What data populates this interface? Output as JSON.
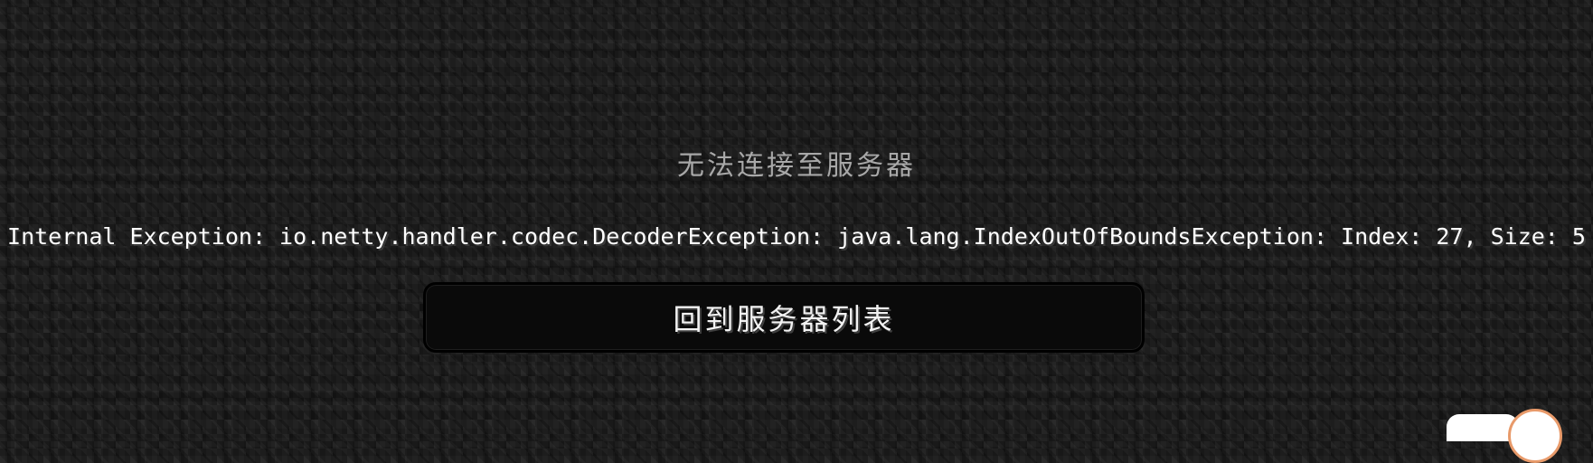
{
  "screen": {
    "title": "无法连接至服务器",
    "message": "Internal Exception: io.netty.handler.codec.DecoderException: java.lang.IndexOutOfBoundsException: Index: 27, Size: 5",
    "back_button_label": "回到服务器列表"
  },
  "colors": {
    "background": "#1d1d1d",
    "title_text": "#a8a8a8",
    "message_text": "#ffffff",
    "button_fill": "#0a0a0a",
    "badge_border": "#e89a6a"
  }
}
